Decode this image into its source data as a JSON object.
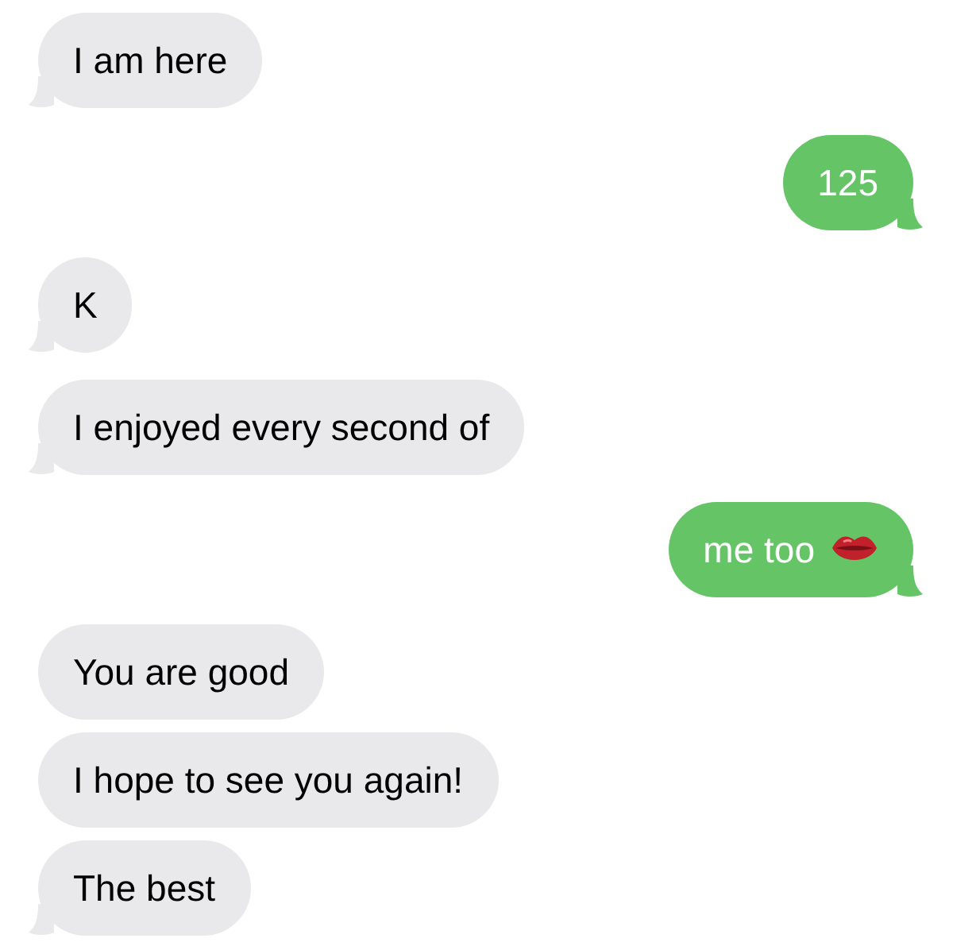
{
  "messages": [
    {
      "kind": "incoming",
      "text": "I am here",
      "tail": true
    },
    {
      "kind": "outgoing",
      "text": "125",
      "tail": true
    },
    {
      "kind": "incoming",
      "text": "K",
      "tail": true
    },
    {
      "kind": "incoming",
      "text": "I enjoyed every second of",
      "tail": true
    },
    {
      "kind": "outgoing",
      "text": "me too",
      "tail": true,
      "trailing_icon": true
    },
    {
      "kind": "incoming",
      "text": "You are good",
      "tail": false
    },
    {
      "kind": "incoming",
      "text": "I hope to see you again!",
      "tail": false
    },
    {
      "kind": "incoming",
      "text": "The best",
      "tail": true
    }
  ]
}
